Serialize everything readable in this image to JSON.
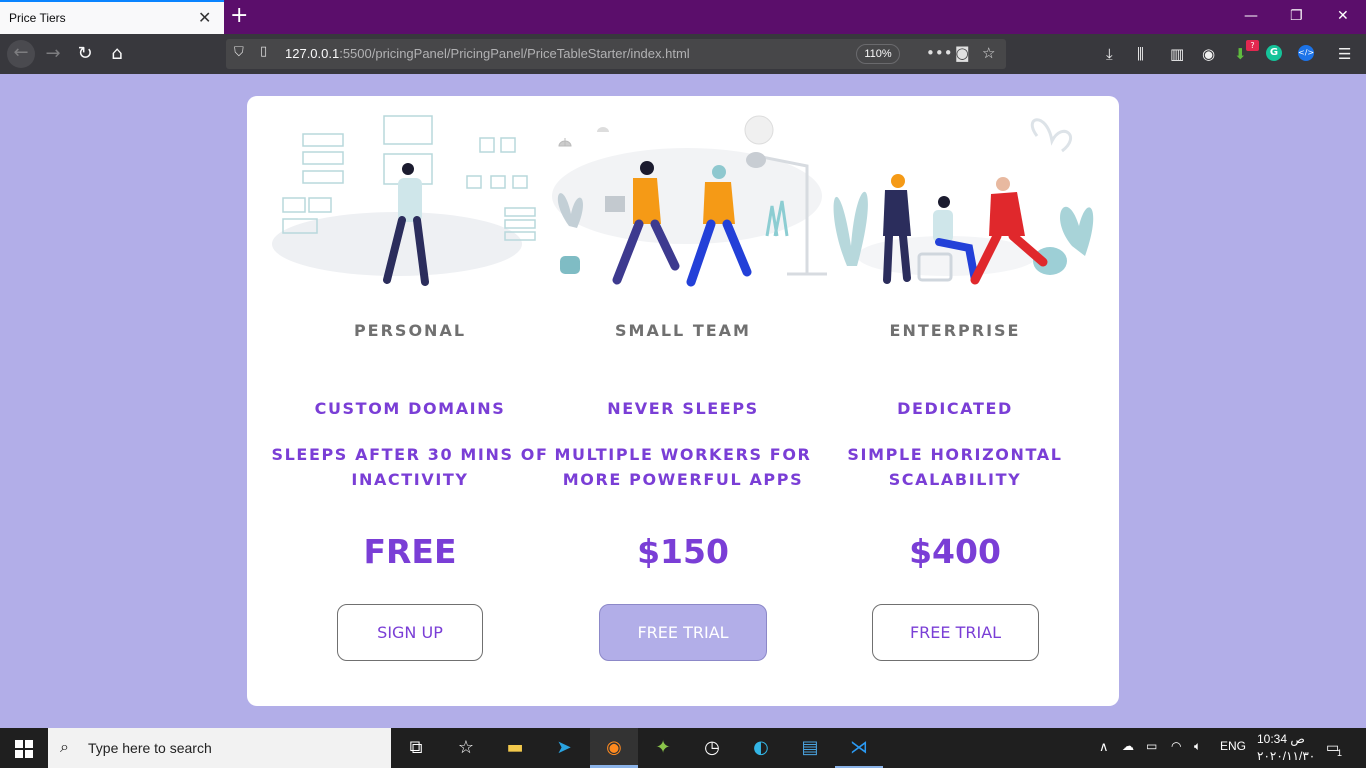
{
  "browser": {
    "tab_title": "Price Tiers",
    "url_host": "127.0.0.1",
    "url_path": ":5500/pricingPanel/PricingPanel/PriceTableStarter/index.html",
    "zoom": "110%",
    "download_badge": "?"
  },
  "tiers": [
    {
      "name": "PERSONAL",
      "feature1": "CUSTOM DOMAINS",
      "feature2": "SLEEPS AFTER 30 MINS OF INACTIVITY",
      "price": "FREE",
      "button": "SIGN UP"
    },
    {
      "name": "SMALL TEAM",
      "feature1": "NEVER SLEEPS",
      "feature2": "MULTIPLE WORKERS FOR MORE POWERFUL APPS",
      "price": "$150",
      "button": "FREE TRIAL"
    },
    {
      "name": "ENTERPRISE",
      "feature1": "DEDICATED",
      "feature2": "SIMPLE HORIZONTAL SCALABILITY",
      "price": "$400",
      "button": "FREE TRIAL"
    }
  ],
  "colors": {
    "page_bg": "#b2aee8",
    "accent": "#7a3ed6",
    "tab_bar": "#5b0e6b"
  },
  "taskbar": {
    "search_placeholder": "Type here to search",
    "lang": "ENG",
    "time": "10:34 ص",
    "date": "٢٠٢٠/١١/٣٠",
    "notification_count": "1"
  }
}
